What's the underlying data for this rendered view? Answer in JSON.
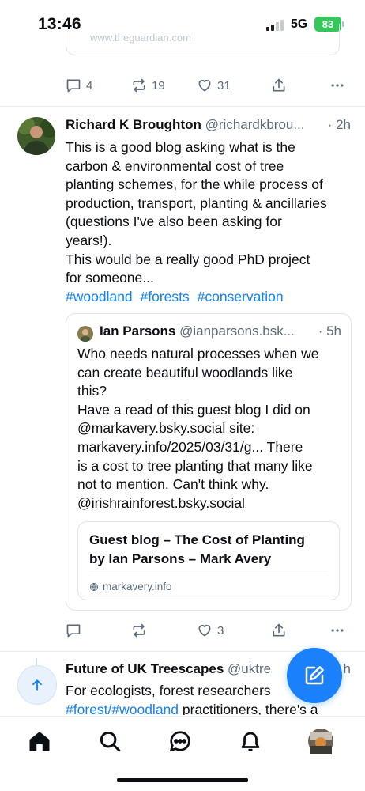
{
  "status_bar": {
    "time": "13:46",
    "network": "5G",
    "battery": "83"
  },
  "prev_post": {
    "link_domain": "www.theguardian.com",
    "actions": {
      "replies": "4",
      "reposts": "19",
      "likes": "31"
    }
  },
  "post": {
    "author_name": "Richard K Broughton",
    "handle": "@richardkbrou...",
    "time": "· 2h",
    "text_lines": [
      "This is a good blog asking what is the",
      "carbon & environmental cost of tree",
      "planting schemes, for the while process of",
      "production, transport, planting & ancillaries",
      "(questions I've also been asking for",
      "years!).",
      "This would be a really good PhD project",
      "for someone..."
    ],
    "hashtags": [
      "#woodland",
      "#forests",
      "#conservation"
    ],
    "quote": {
      "author_name": "Ian Parsons",
      "handle": "@ianparsons.bsk...",
      "time": "· 5h",
      "text_lines": [
        "Who needs natural processes when we",
        "can create beautiful woodlands like",
        "this?",
        "Have a read of this guest blog I did on",
        "@markavery.bsky.social site:",
        "markavery.info/2025/03/31/g... There",
        "is a cost to tree planting that many like",
        "not to mention. Can't think why.",
        "@irishrainforest.bsky.social"
      ],
      "link_card": {
        "title_lines": [
          "Guest blog – The Cost of Planting",
          "by Ian Parsons – Mark Avery"
        ],
        "domain": "markavery.info"
      }
    },
    "actions": {
      "replies": "",
      "reposts": "",
      "likes": "3"
    }
  },
  "next_post": {
    "author_name": "Future of UK Treescapes",
    "handle": "@uktre",
    "time": "h",
    "text_line1": "For ecologists, forest researchers",
    "text_line2_hashtag": "#forest/#woodland",
    "text_line2_rest": " practitioners, there's a"
  },
  "icons": {
    "reply": "reply-icon",
    "repost": "repost-icon",
    "like": "heart-icon",
    "share": "share-icon",
    "more": "more-icon",
    "compose": "compose-icon",
    "scroll_top": "arrow-up-icon",
    "home": "home-icon",
    "search": "search-icon",
    "chat": "chat-icon",
    "notifications": "bell-icon",
    "profile": "profile-avatar"
  },
  "colors": {
    "accent": "#1083fe",
    "muted": "#5b6b7a",
    "battery": "#34c759"
  }
}
